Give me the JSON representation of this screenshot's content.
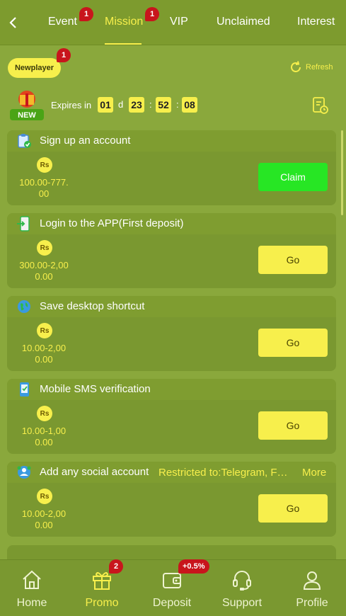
{
  "header": {
    "tabs": [
      {
        "label": "Event",
        "badge": "1"
      },
      {
        "label": "Mission",
        "badge": "1",
        "active": true
      },
      {
        "label": "VIP"
      },
      {
        "label": "Unclaimed"
      },
      {
        "label": "Interest"
      }
    ]
  },
  "filter": {
    "newplayer_label": "Newplayer",
    "newplayer_badge": "1",
    "refresh_label": "Refresh"
  },
  "timer": {
    "new_tag": "NEW",
    "label": "Expires in",
    "days": "01",
    "day_unit": "d",
    "hours": "23",
    "minutes": "52",
    "seconds": "08",
    "sep": ":"
  },
  "missions": [
    {
      "title": "Sign up an account",
      "currency": "Rs",
      "amount_line1": "100.00-777.",
      "amount_line2": "00",
      "button": "Claim"
    },
    {
      "title": "Login to the APP(First deposit)",
      "currency": "Rs",
      "amount_line1": "300.00-2,00",
      "amount_line2": "0.00",
      "button": "Go"
    },
    {
      "title": "Save desktop shortcut",
      "currency": "Rs",
      "amount_line1": "10.00-2,00",
      "amount_line2": "0.00",
      "button": "Go"
    },
    {
      "title": "Mobile SMS verification",
      "currency": "Rs",
      "amount_line1": "10.00-1,00",
      "amount_line2": "0.00",
      "button": "Go"
    },
    {
      "title": "Add any social account",
      "restriction": "Restricted to:Telegram, F…",
      "more": "More",
      "currency": "Rs",
      "amount_line1": "10.00-2,00",
      "amount_line2": "0.00",
      "button": "Go"
    }
  ],
  "bottom_nav": {
    "items": [
      {
        "label": "Home"
      },
      {
        "label": "Promo",
        "badge": "2",
        "active": true
      },
      {
        "label": "Deposit",
        "badge": "+0.5%"
      },
      {
        "label": "Support"
      },
      {
        "label": "Profile"
      }
    ]
  },
  "colors": {
    "background": "#8aa83c",
    "accent": "#f7ef4c",
    "claim": "#27e624",
    "badge": "#c8151c"
  }
}
